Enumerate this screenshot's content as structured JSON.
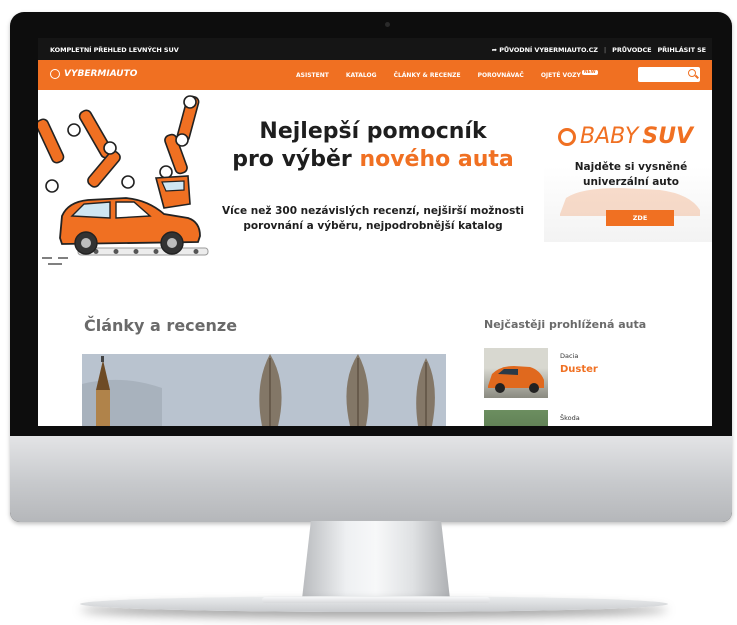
{
  "topbar": {
    "tagline": "KOMPLETNÍ PŘEHLED LEVNÝCH SUV",
    "back_link": "PŮVODNÍ VYBERMIAUTO.CZ",
    "guide": "PRŮVODCE",
    "login": "PŘIHLÁSIT SE"
  },
  "nav": {
    "logo": "VYBERMIAUTO",
    "menu": [
      {
        "label": "ASISTENT"
      },
      {
        "label": "KATALOG"
      },
      {
        "label": "ČLÁNKY & RECENZE"
      },
      {
        "label": "POROVNÁVAČ"
      },
      {
        "label": "OJETÉ VOZY",
        "badge": "NEW"
      }
    ],
    "search_placeholder": ""
  },
  "hero": {
    "title_line1": "Nejlepší pomocník",
    "title_line2_prefix": "pro výběr ",
    "title_line2_accent": "nového auta",
    "subtitle_line1": "Více než 300 nezávislých recenzí, nejširší možnosti",
    "subtitle_line2": "porovnání a výběru, nejpodrobnější katalog"
  },
  "baby_suv": {
    "brand_light": "BABY",
    "brand_bold": "SUV",
    "text_line1": "Najděte si vysněné",
    "text_line2": "univerzální auto",
    "cta": "ZDE"
  },
  "articles": {
    "title": "Články a recenze"
  },
  "most_viewed": {
    "title": "Nejčastěji prohlížená auta",
    "items": [
      {
        "make": "Dacia",
        "model": "Duster"
      },
      {
        "make": "Škoda",
        "model": ""
      }
    ]
  },
  "colors": {
    "accent": "#f07022",
    "topbar": "#151515",
    "monitor_bezel": "#0d0d0d"
  },
  "icons": {
    "back_arrow": "reply-arrow-icon",
    "logo": "steering-wheel-icon",
    "search": "search-icon"
  }
}
